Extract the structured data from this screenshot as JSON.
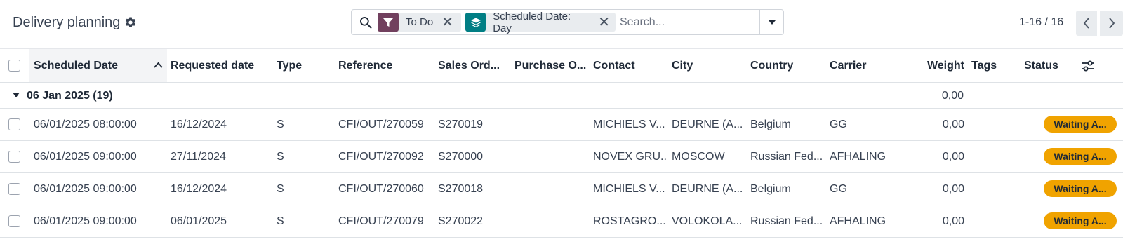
{
  "header": {
    "title": "Delivery planning"
  },
  "search": {
    "facets": [
      {
        "label": "To Do",
        "icon": "filter-icon",
        "color": "#71405e"
      },
      {
        "label": "Scheduled Date: Day",
        "icon": "layers-icon",
        "color": "#017e84"
      }
    ],
    "placeholder": "Search..."
  },
  "pager": {
    "value": "1-16 / 16"
  },
  "columns": [
    "Scheduled Date",
    "Requested date",
    "Type",
    "Reference",
    "Sales Ord...",
    "Purchase O...",
    "Contact",
    "City",
    "Country",
    "Carrier",
    "Weight",
    "Tags",
    "Status"
  ],
  "group": {
    "label": "06 Jan 2025 (19)",
    "weight": "0,00"
  },
  "rows": [
    {
      "scheduled": "06/01/2025 08:00:00",
      "requested": "16/12/2024",
      "type": "S",
      "reference": "CFI/OUT/270059",
      "sales_order": "S270019",
      "purchase_order": "",
      "contact": "MICHIELS V...",
      "city": "DEURNE (A...",
      "country": "Belgium",
      "carrier": "GG",
      "weight": "0,00",
      "tags": "",
      "status": "Waiting A..."
    },
    {
      "scheduled": "06/01/2025 09:00:00",
      "requested": "27/11/2024",
      "type": "S",
      "reference": "CFI/OUT/270092",
      "sales_order": "S270000",
      "purchase_order": "",
      "contact": "NOVEX GRU...",
      "city": "MOSCOW",
      "country": "Russian Fed...",
      "carrier": "AFHALING",
      "weight": "0,00",
      "tags": "",
      "status": "Waiting A..."
    },
    {
      "scheduled": "06/01/2025 09:00:00",
      "requested": "16/12/2024",
      "type": "S",
      "reference": "CFI/OUT/270060",
      "sales_order": "S270018",
      "purchase_order": "",
      "contact": "MICHIELS V...",
      "city": "DEURNE (A...",
      "country": "Belgium",
      "carrier": "GG",
      "weight": "0,00",
      "tags": "",
      "status": "Waiting A..."
    },
    {
      "scheduled": "06/01/2025 09:00:00",
      "requested": "06/01/2025",
      "type": "S",
      "reference": "CFI/OUT/270079",
      "sales_order": "S270022",
      "purchase_order": "",
      "contact": "ROSTAGRO...",
      "city": "VOLOKOLA...",
      "country": "Russian Fed...",
      "carrier": "AFHALING",
      "weight": "0,00",
      "tags": "",
      "status": "Waiting A..."
    }
  ],
  "colors": {
    "status_badge": "#f0a300",
    "filter_facet": "#71405e",
    "group_facet": "#017e84"
  }
}
